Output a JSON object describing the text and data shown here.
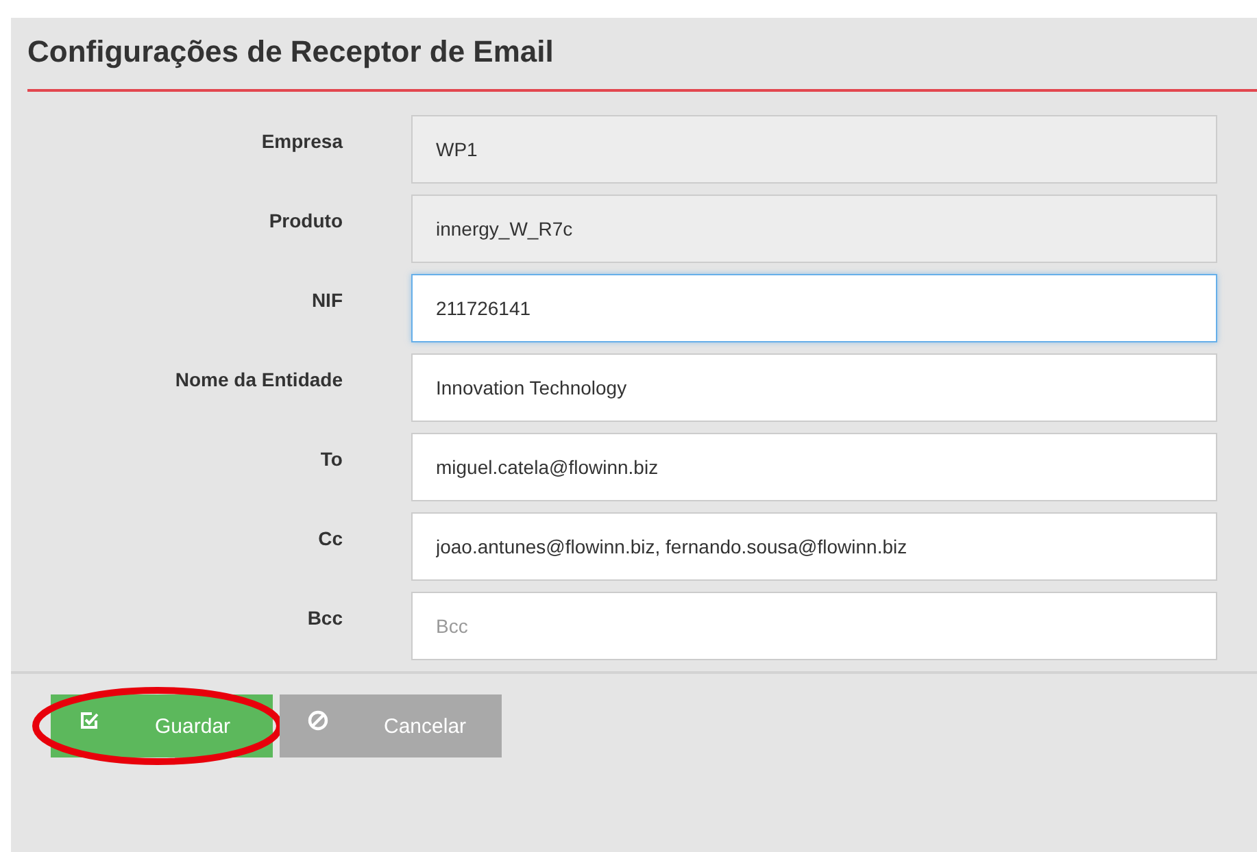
{
  "title": "Configurações de Receptor de Email",
  "fields": [
    {
      "label": "Empresa",
      "value": "WP1",
      "disabled": true,
      "focused": false
    },
    {
      "label": "Produto",
      "value": "innergy_W_R7c",
      "disabled": true,
      "focused": false
    },
    {
      "label": "NIF",
      "value": "211726141",
      "disabled": false,
      "focused": true
    },
    {
      "label": "Nome da Entidade",
      "value": "Innovation Technology",
      "disabled": false,
      "focused": false
    },
    {
      "label": "To",
      "value": "miguel.catela@flowinn.biz",
      "disabled": false,
      "focused": false
    },
    {
      "label": "Cc",
      "value": "joao.antunes@flowinn.biz, fernando.sousa@flowinn.biz",
      "disabled": false,
      "focused": false
    },
    {
      "label": "Bcc",
      "placeholder": "Bcc",
      "disabled": false,
      "focused": false
    }
  ],
  "buttons": [
    {
      "label": "Guardar",
      "kind": "save",
      "circled": true
    },
    {
      "label": "Cancelar",
      "kind": "cancel",
      "circled": false
    }
  ]
}
